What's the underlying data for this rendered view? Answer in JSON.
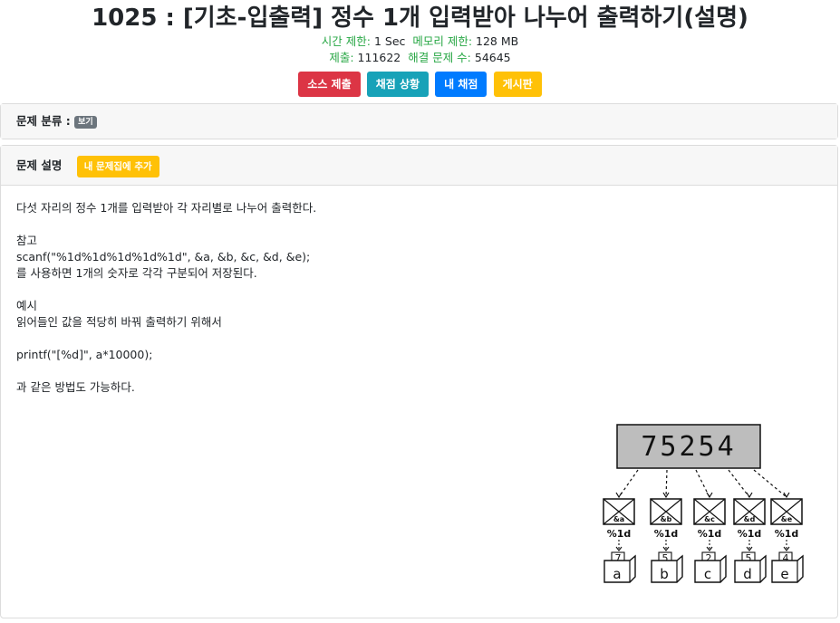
{
  "problem": {
    "title": "1025 : [기초-입출력] 정수 1개 입력받아 나누어 출력하기(설명)",
    "time_limit_label": "시간 제한:",
    "time_limit_value": "1 Sec",
    "memory_limit_label": "메모리 제한:",
    "memory_limit_value": "128 MB",
    "submissions_label": "제출:",
    "submissions_value": "111622",
    "solved_label": "해결 문제 수:",
    "solved_value": "54645"
  },
  "buttons": {
    "submit": "소스 제출",
    "status": "채점 상황",
    "my_status": "내 채점",
    "board": "게시판"
  },
  "category": {
    "label": "문제 분류 :",
    "show": "보기"
  },
  "description": {
    "heading": "문제 설명",
    "add_button": "내 문제집에 추가",
    "lines": [
      "다섯 자리의 정수 1개를 입력받아 각 자리별로 나누어 출력한다.",
      "참고",
      "scanf(\"%1d%1d%1d%1d%1d\", &a, &b, &c, &d, &e);",
      "를 사용하면 1개의 숫자로 각각 구분되어 저장된다.",
      "예시",
      "읽어들인 값을 적당히 바꿔 출력하기 위해서",
      "printf(\"[%d]\", a*10000);",
      "과 같은 방법도 가능하다."
    ]
  },
  "illustration": {
    "number": "75254",
    "vars": [
      "&a",
      "&b",
      "&c",
      "&d",
      "&e"
    ],
    "format": "%1d",
    "digits": [
      "7",
      "5",
      "2",
      "5",
      "4"
    ],
    "boxes": [
      "a",
      "b",
      "c",
      "d",
      "e"
    ]
  },
  "colors": {
    "label_green": "#28a745",
    "red": "#dc3545",
    "teal": "#17a2b8",
    "blue": "#007bff",
    "yellow": "#ffc107",
    "gray_badge": "#6c757d"
  }
}
